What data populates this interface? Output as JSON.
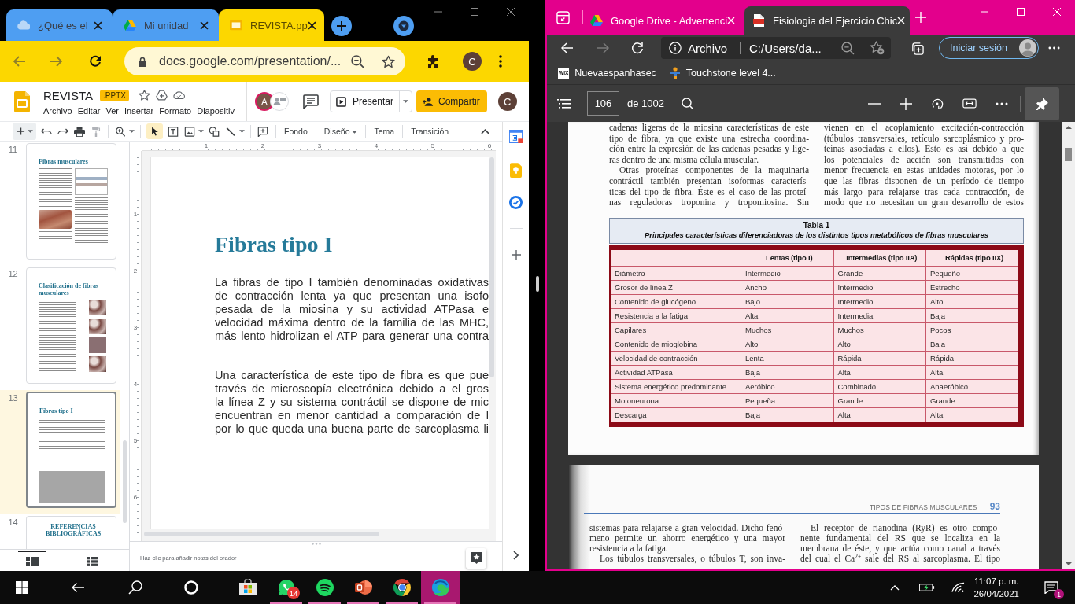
{
  "left_window": {
    "tabs": [
      {
        "kind": "cloud",
        "title": "¿Qué es el",
        "selected": false
      },
      {
        "kind": "drive",
        "title": "Mi unidad",
        "selected": false
      },
      {
        "kind": "slides",
        "title": "REVISTA.pp",
        "selected": true
      }
    ],
    "address": "docs.google.com/presentation/...",
    "profile_initial": "C",
    "slides_app": {
      "file_name": "REVISTA",
      "file_badge": ".PPTX",
      "menu": [
        "Archivo",
        "Editar",
        "Ver",
        "Insertar",
        "Formato",
        "Diapositiv"
      ],
      "collaborator_initial": "A",
      "present_label": "Presentar",
      "share_label": "Compartir",
      "account_initial": "C",
      "pointer_tool": {
        "selected": true
      },
      "text_tools": [
        {
          "label": "Fondo",
          "dropdown": false
        },
        {
          "label": "Diseño",
          "dropdown": true
        },
        {
          "label": "Tema",
          "dropdown": false
        },
        {
          "label": "Transición",
          "dropdown": false
        }
      ],
      "ruler": {
        "horizontal": [
          "1",
          "2",
          "3",
          "4",
          "5",
          "6"
        ],
        "vertical": [
          "1",
          "2",
          "3",
          "4",
          "5",
          "6"
        ]
      },
      "filmstrip": [
        {
          "number": "11",
          "kind": "article",
          "title": "Fibras musculares",
          "selected": false
        },
        {
          "number": "12",
          "kind": "gallery",
          "title": "Clasificación de fibras musculares",
          "selected": false
        },
        {
          "number": "13",
          "kind": "text_block",
          "title": "Fibras tipo I",
          "selected": true
        },
        {
          "number": "14",
          "kind": "title_only",
          "title": "REFERENCIAS BIBLIOGRÁFICAS",
          "selected": false
        }
      ],
      "view_modes": [
        {
          "kind": "list",
          "selected": true
        },
        {
          "kind": "grid",
          "selected": false
        }
      ],
      "slide": {
        "title": "Fibras tipo I",
        "paragraphs": [
          [
            "La fibras de tipo I también denominadas oxidativas",
            "de contracción lenta ya que presentan una isofo",
            "pesada de la miosina y su actividad ATPasa e",
            "velocidad máxima dentro de la familia de las MHC,",
            "más lento hidrolizan el ATP para generar una contra"
          ],
          [
            "Una característica de este tipo de fibra es que pue",
            "través de microscopía electrónica debido a el gros",
            "la línea Z y su sistema contráctil se dispone de mic",
            "encuentran en menor cantidad a comparación de l",
            "por lo que queda una buena parte de sarcoplasma li"
          ]
        ]
      },
      "notes_placeholder": "Haz clic para añadir notas del orador"
    }
  },
  "right_window": {
    "tabs": [
      {
        "kind": "drive",
        "title": "Google Drive - Advertenci",
        "selected": false
      },
      {
        "kind": "pdf",
        "title": "Fisiologia del Ejercicio Chic",
        "selected": true
      }
    ],
    "address": {
      "label": "Archivo",
      "path": "C:/Users/da..."
    },
    "sign_in": "Iniciar sesión",
    "favorites": [
      {
        "kind": "wix",
        "logo_text": "WIX",
        "title": "Nuevaespanhasec"
      },
      {
        "kind": "figure",
        "title": "Touchstone level 4..."
      }
    ],
    "pdf_toolbar": {
      "page": "106",
      "page_total": "de 1002",
      "pin": {
        "selected": true
      }
    },
    "pages": [
      {
        "kind": "table_page",
        "columns": [
          [
            {
              "continued": true,
              "lines": [
                "cadenas ligeras de la miosina características de este",
                "tipo de fibra, ya que existe una estrecha coordina-",
                "ción entre la expresión de las cadenas pesadas y lige-",
                "ras dentro de una misma célula muscular."
              ]
            },
            {
              "continued": false,
              "lines": [
                "Otras proteínas componentes de la maquinaria",
                "contráctil también presentan isoformas caracterís-",
                "ticas del tipo de fibra. Éste es el caso de las proteí-",
                "nas reguladoras troponina y tropomiosina. Sin"
              ]
            }
          ],
          [
            {
              "continued": true,
              "lines": [
                "vienen en el acoplamiento excitación-contracción",
                "(túbulos transversales, retículo sarcoplásmico y pro-",
                "teínas asociadas a ellos). Esto es así debido a que",
                "los potenciales de acción son transmitidos con",
                "menor frecuencia en estas unidades motoras, por lo",
                "que las fibras disponen de un período de tiempo",
                "más largo para relajarse tras cada contracción, de",
                "modo que no necesitan un gran desarrollo de estos"
              ]
            }
          ]
        ],
        "table": {
          "number": "Tabla 1",
          "caption": "Principales características diferenciadoras de los distintos tipos metabólicos de fibras musculares",
          "columns": [
            "Lentas (tipo I)",
            "Intermedias (tipo IIA)",
            "Rápidas (tipo IIX)"
          ],
          "rows": [
            {
              "label": "Diámetro",
              "values": [
                "Intermedio",
                "Grande",
                "Pequeño"
              ]
            },
            {
              "label": "Grosor de línea Z",
              "values": [
                "Ancho",
                "Intermedio",
                "Estrecho"
              ]
            },
            {
              "label": "Contenido de glucógeno",
              "values": [
                "Bajo",
                "Intermedio",
                "Alto"
              ]
            },
            {
              "label": "Resistencia a la fatiga",
              "values": [
                "Alta",
                "Intermedia",
                "Baja"
              ]
            },
            {
              "label": "Capilares",
              "values": [
                "Muchos",
                "Muchos",
                "Pocos"
              ]
            },
            {
              "label": "Contenido de mioglobina",
              "values": [
                "Alto",
                "Alto",
                "Baja"
              ]
            },
            {
              "label": "Velocidad de contracción",
              "values": [
                "Lenta",
                "Rápida",
                "Rápida"
              ]
            },
            {
              "label": "Actividad ATPasa",
              "values": [
                "Baja",
                "Alta",
                "Alta"
              ]
            },
            {
              "label": "Sistema energético predominante",
              "values": [
                "Aeróbico",
                "Combinado",
                "Anaeróbico"
              ]
            },
            {
              "label": "Motoneurona",
              "values": [
                "Pequeña",
                "Grande",
                "Grande"
              ]
            },
            {
              "label": "Descarga",
              "values": [
                "Baja",
                "Alta",
                "Alta"
              ]
            }
          ]
        }
      },
      {
        "kind": "headed_page",
        "running_head": "TIPOS DE FIBRAS MUSCULARES",
        "page_number": "93",
        "columns": [
          [
            {
              "continued": true,
              "lines": [
                "sistemas para relajarse a gran velocidad. Dicho fenó-",
                "meno permite un ahorro energético y una mayor",
                "resistencia a la fatiga."
              ]
            },
            {
              "continued": false,
              "lines": [
                "Los túbulos transversales, o túbulos T, son inva-"
              ]
            }
          ],
          [
            {
              "continued": false,
              "lines": [
                "El receptor de rianodina (RyR) es otro compo-",
                "nente fundamental del RS que se localiza en la",
                "membrana de éste, y que actúa como canal a través",
                "del cual el Ca$^{2+}$ sale del RS al sarcoplasma. El tipo"
              ]
            }
          ]
        ]
      }
    ]
  },
  "taskbar": {
    "apps": [
      {
        "kind": "store",
        "running": false,
        "selected": false
      },
      {
        "kind": "whatsapp",
        "badge": "14",
        "running": true,
        "selected": false
      },
      {
        "kind": "spotify",
        "running": true,
        "selected": false
      },
      {
        "kind": "powerpoint",
        "running": true,
        "selected": false
      },
      {
        "kind": "chrome",
        "running": true,
        "selected": false
      },
      {
        "kind": "edge",
        "running": true,
        "selected": true
      }
    ],
    "time": "11:07 p. m.",
    "date": "26/04/2021",
    "notifications": "1"
  }
}
